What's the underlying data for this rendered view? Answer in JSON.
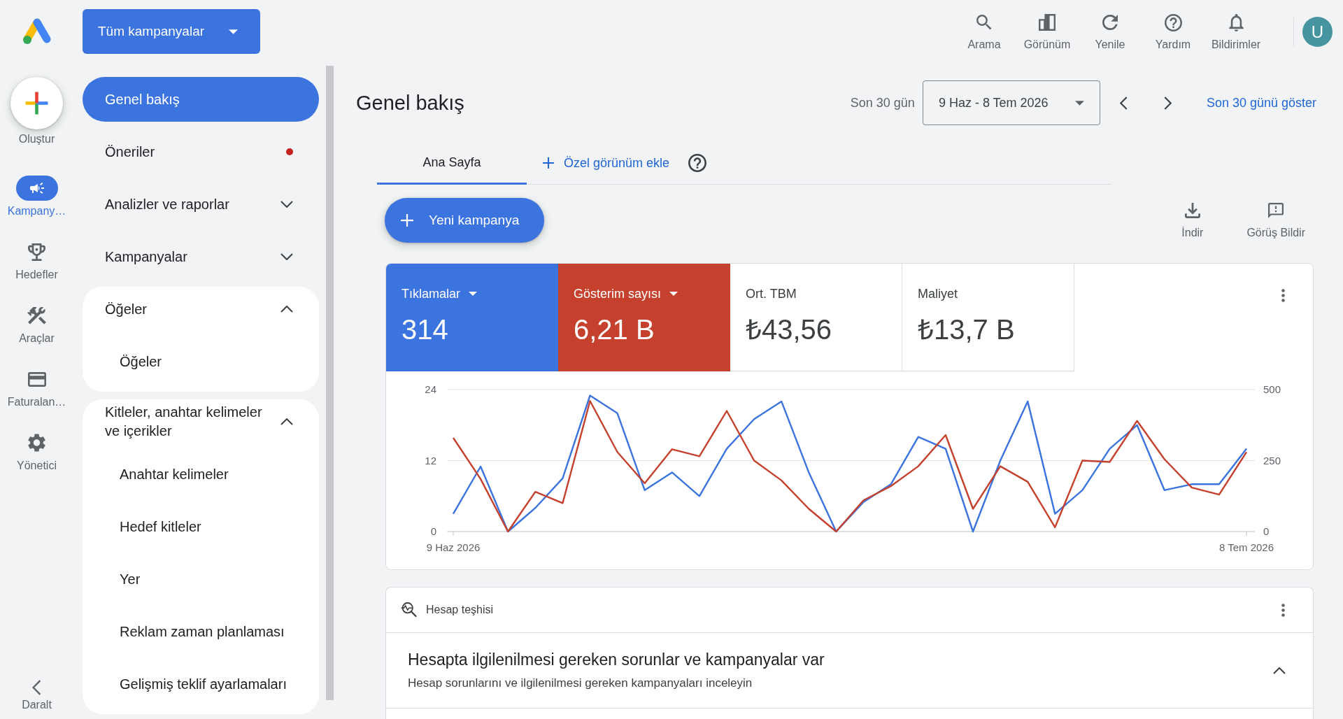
{
  "rail": {
    "create": "Oluştur",
    "items": [
      {
        "label": "Kampany…",
        "selected": true
      },
      {
        "label": "Hedefler",
        "selected": false
      },
      {
        "label": "Araçlar",
        "selected": false
      },
      {
        "label": "Faturalan…",
        "selected": false
      },
      {
        "label": "Yönetici",
        "selected": false
      }
    ],
    "collapse": "Daralt"
  },
  "sidebar": {
    "scope": "Tüm kampanyalar",
    "items": [
      {
        "kind": "link",
        "label": "Genel bakış",
        "selected": true,
        "alert": false
      },
      {
        "kind": "link",
        "label": "Öneriler",
        "selected": false,
        "alert": true
      },
      {
        "kind": "group",
        "label": "Analizler ve raporlar",
        "selected": false,
        "alert": false,
        "expanded": false
      },
      {
        "kind": "group",
        "label": "Kampanyalar",
        "selected": false,
        "alert": false,
        "expanded": false
      },
      {
        "kind": "group",
        "label": "Öğeler",
        "selected": false,
        "alert": false,
        "expanded": true,
        "children": [
          {
            "label": "Öğeler",
            "selected": false
          }
        ]
      },
      {
        "kind": "group",
        "label": "Kitleler, anahtar kelimeler ve içerikler",
        "selected": false,
        "alert": false,
        "expanded": true,
        "children": [
          {
            "label": "Anahtar kelimeler",
            "selected": false
          },
          {
            "label": "Hedef kitleler",
            "selected": false
          },
          {
            "label": "Yer",
            "selected": false
          },
          {
            "label": "Reklam zaman planlaması",
            "selected": false
          },
          {
            "label": "Gelişmiş teklif ayarlamaları",
            "selected": false
          }
        ]
      }
    ]
  },
  "toolbar": [
    {
      "label": "Arama"
    },
    {
      "label": "Görünüm"
    },
    {
      "label": "Yenile"
    },
    {
      "label": "Yardım"
    },
    {
      "label": "Bildirimler"
    }
  ],
  "account": {
    "initial": "U"
  },
  "header": {
    "title": "Genel bakış",
    "date_preset": "Son 30 gün",
    "date_range": "9 Haz - 8 Tem 2026",
    "reset_link": "Son 30 günü göster"
  },
  "tabs": [
    {
      "label": "Ana Sayfa",
      "selected": true
    }
  ],
  "add_view": "Özel görünüm ekle",
  "actions": {
    "new_campaign": "Yeni kampanya",
    "tools": [
      {
        "label": "İndir"
      },
      {
        "label": "Görüş Bildir"
      }
    ]
  },
  "metrics": [
    {
      "label": "Tıklamalar",
      "value": "314",
      "selected": true
    },
    {
      "label": "Gösterim sayısı",
      "value": "6,21 B",
      "selected": true
    },
    {
      "label": "Ort. TBM",
      "value": "₺43,56",
      "selected": false
    },
    {
      "label": "Maliyet",
      "value": "₺13,7 B",
      "selected": false
    }
  ],
  "chart_data": {
    "type": "line",
    "categories": [
      "9 Haz 2026",
      null,
      null,
      null,
      null,
      null,
      null,
      null,
      null,
      null,
      null,
      null,
      null,
      null,
      null,
      null,
      null,
      null,
      null,
      null,
      null,
      null,
      null,
      null,
      null,
      null,
      null,
      null,
      null,
      "8 Tem 2026"
    ],
    "ylim": [
      0,
      24
    ],
    "yticks": [
      0,
      12,
      24
    ],
    "y2lim": [
      0,
      500
    ],
    "y2ticks": [
      0,
      250,
      500
    ],
    "series": [
      {
        "color": "#3b73df",
        "values": [
          3,
          11,
          0,
          4,
          9,
          23,
          20,
          7,
          10,
          6,
          14,
          19,
          22,
          10,
          0,
          5,
          8,
          16,
          14,
          0,
          12,
          22,
          3,
          7,
          14,
          18,
          7,
          8,
          8,
          14
        ]
      },
      {
        "axis": "y2",
        "color": "#c5412e",
        "values": [
          330,
          185,
          0,
          140,
          100,
          460,
          280,
          170,
          290,
          265,
          425,
          250,
          180,
          80,
          0,
          110,
          160,
          230,
          340,
          80,
          230,
          175,
          15,
          250,
          245,
          390,
          255,
          155,
          130,
          280
        ]
      }
    ]
  },
  "diagnostics": {
    "title": "Hesap teşhisi",
    "issue": {
      "title": "Hesapta ilgilenilmesi gereken sorunlar ve kampanyalar var",
      "description": "Hesap sorunlarını ve ilgilenilmesi gereken kampanyaları inceleyin",
      "expanded": true
    }
  }
}
